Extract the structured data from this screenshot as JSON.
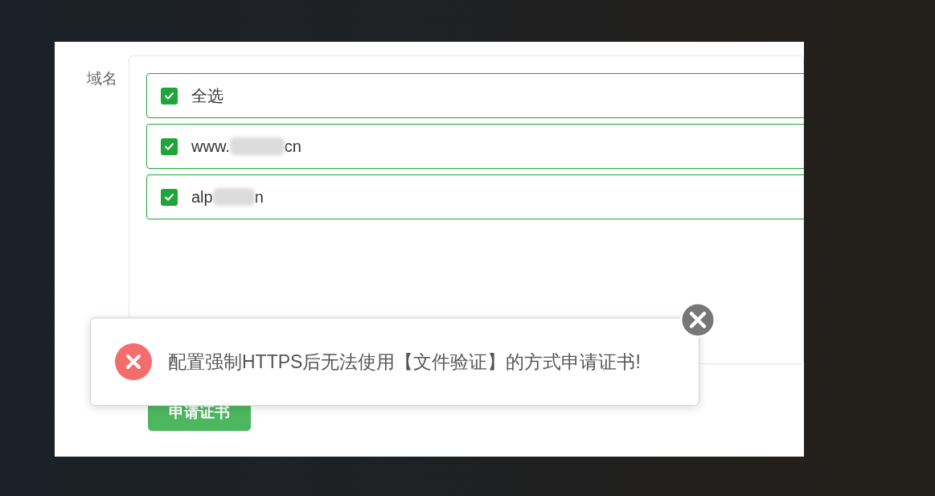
{
  "form": {
    "label": "域名",
    "options": [
      {
        "kind": "all",
        "label_parts": [
          "全选"
        ],
        "checked": true
      },
      {
        "kind": "domain",
        "label_parts": [
          "www.",
          "cn"
        ],
        "checked": true
      },
      {
        "kind": "domain",
        "label_parts": [
          "alp",
          "n"
        ],
        "checked": true
      }
    ],
    "submit_button": "申请证书"
  },
  "toast": {
    "kind": "error",
    "message": "配置强制HTTPS后无法使用【文件验证】的方式申请证书!"
  }
}
